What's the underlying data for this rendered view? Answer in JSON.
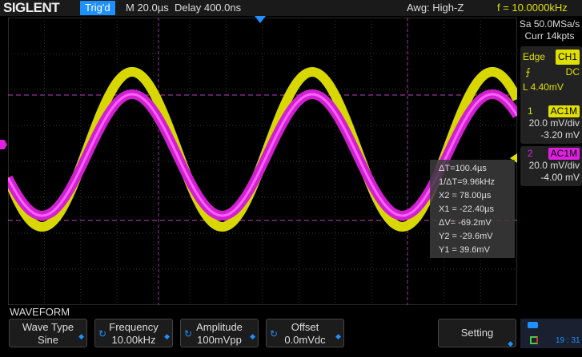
{
  "header": {
    "logo": "SIGLENT",
    "trig_status": "Trig'd",
    "timebase": "M 20.0µs",
    "delay": "Delay 400.0ns",
    "awg": "Awg: High-Z",
    "frequency": "f = 10.0000kHz"
  },
  "acquisition": {
    "sample_rate": "Sa 50.0MSa/s",
    "memory": "Curr 14kpts"
  },
  "trigger": {
    "type": "Edge",
    "source": "CH1",
    "coupling": "DC",
    "level": "L  4.40mV"
  },
  "channels": [
    {
      "num": "1",
      "coupling": "AC1M",
      "scale": "20.0 mV/div",
      "offset": "-3.20 mV",
      "color": "#f0f000"
    },
    {
      "num": "2",
      "coupling": "AC1M",
      "scale": "20.0 mV/div",
      "offset": "-4.00 mV",
      "color": "#e020e0"
    }
  ],
  "cursors": [
    "ΔT=100.4µs",
    "1/ΔT=9.96kHz",
    "X2 = 78.00µs",
    "X1 = -22.40µs",
    "ΔV= -69.2mV",
    "Y2 = -29.6mV",
    "Y1 = 39.6mV"
  ],
  "menu": {
    "title": "WAVEFORM",
    "buttons": [
      {
        "label": "Wave Type",
        "value": "Sine"
      },
      {
        "label": "Frequency",
        "value": "10.00kHz"
      },
      {
        "label": "Amplitude",
        "value": "100mVpp"
      },
      {
        "label": "Offset",
        "value": "0.0mVdc"
      },
      {
        "label": "Setting",
        "value": ""
      }
    ]
  },
  "status": {
    "time": "19 : 31"
  }
}
